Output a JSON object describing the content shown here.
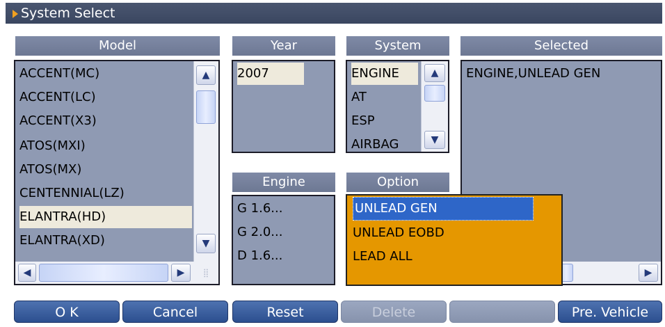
{
  "window": {
    "title": "System Select"
  },
  "headers": {
    "model": "Model",
    "year": "Year",
    "system": "System",
    "selected": "Selected",
    "engine": "Engine",
    "option": "Option"
  },
  "model_list": [
    "ACCENT(MC)",
    "ACCENT(LC)",
    "ACCENT(X3)",
    "ATOS(MXI)",
    "ATOS(MX)",
    "CENTENNIAL(LZ)",
    "ELANTRA(HD)",
    "ELANTRA(XD)"
  ],
  "model_selected": "ELANTRA(HD)",
  "year_list": [
    "2007"
  ],
  "system_list": [
    "ENGINE",
    "AT",
    "ESP",
    "AIRBAG"
  ],
  "engine_list": [
    "G 1.6...",
    "G 2.0...",
    "D 1.6..."
  ],
  "option_list": [
    "UNLEAD GEN",
    "UNLEAD EOBD",
    "LEAD ALL"
  ],
  "option_selected": "UNLEAD GEN",
  "selected_text": "ENGINE,UNLEAD GEN",
  "buttons": {
    "ok": "O K",
    "cancel": "Cancel",
    "reset": "Reset",
    "delete": "Delete",
    "blank": "",
    "prev_vehicle": "Pre. Vehicle"
  },
  "colors": {
    "accent": "#e59700",
    "selection": "#2e66c8",
    "panel": "#8f9ab3"
  }
}
